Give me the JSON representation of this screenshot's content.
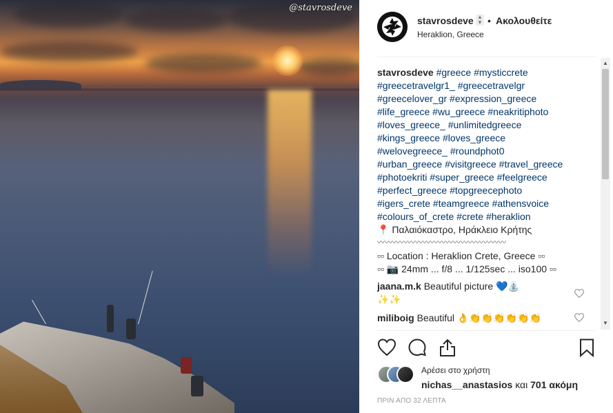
{
  "photo": {
    "watermark": "@stavrosdeve"
  },
  "header": {
    "username": "stavrosdeve",
    "separator": "•",
    "follow_label": "Ακολουθείτε",
    "location": "Heraklion, Greece"
  },
  "caption": {
    "username": "stavrosdeve",
    "hashtag_lines": [
      "#greece #mysticcrete",
      "#greecetravelgr1_ #greecetravelgr",
      "#greecelover_gr #expression_greece",
      "#life_greece #wu_greece #neakritiphoto",
      "#loves_greece_ #unlimitedgreece",
      "#kings_greece #loves_greece",
      "#welovegreece_ #roundphot0",
      "#urban_greece #visitgreece #travel_greece",
      "#photoekriti #super_greece #feelgreece",
      "#perfect_greece #topgreecephoto",
      "#igers_crete #teamgreece #athensvoice",
      "#colours_of_crete #crete #heraklion"
    ],
    "place_pin": "📍",
    "place": "Παλαιόκαστρο, Ηράκλειο Κρήτης",
    "wave_line": "〰〰〰〰〰〰〰〰〰〰〰〰〰〰〰〰〰",
    "location_line": "▫▫ Location : Heraklion Crete, Greece ▫▫",
    "camera_line": "▫▫ 📷 24mm ... f/8 ... 1/125sec ... iso100 ▫▫"
  },
  "comments": [
    {
      "user": "jaana.m.k",
      "text": "Beautiful picture 💙⛲",
      "text2": "✨✨"
    },
    {
      "user": "miliboig",
      "text": "Beautiful 👌👏👏👏👏👏👏"
    }
  ],
  "actions": {
    "like_icon": "heart-icon",
    "comment_icon": "comment-icon",
    "share_icon": "share-icon",
    "save_icon": "bookmark-icon"
  },
  "likes": {
    "liked_by_label": "Αρέσει στο χρήστη",
    "liked_names": "nichas__anastasios",
    "and_label": "και",
    "others": "701 ακόμη"
  },
  "time_ago": "ΠΡΙΝ ΑΠΟ 32 ΛΕΠΤΑ"
}
